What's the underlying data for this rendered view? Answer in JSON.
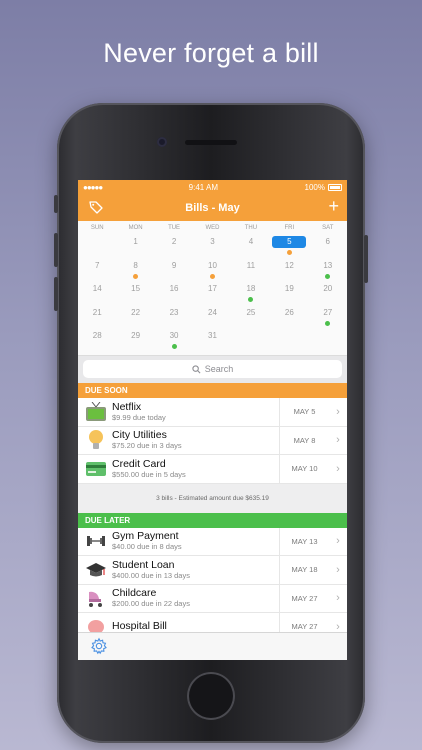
{
  "headline": "Never forget a bill",
  "status": {
    "carrier_dots": "●●●●●",
    "time": "9:41 AM",
    "battery": "100%"
  },
  "nav": {
    "title": "Bills - May",
    "tag_icon": "tag-icon",
    "add_label": "+"
  },
  "calendar": {
    "weekdays": [
      "SUN",
      "MON",
      "TUE",
      "WED",
      "THU",
      "FRI",
      "SAT"
    ],
    "weeks": [
      [
        {
          "d": ""
        },
        {
          "d": "1"
        },
        {
          "d": "2"
        },
        {
          "d": "3"
        },
        {
          "d": "4"
        },
        {
          "d": "5",
          "today": true,
          "dot": "#f5a03a"
        },
        {
          "d": "6"
        }
      ],
      [
        {
          "d": "7"
        },
        {
          "d": "8",
          "dot": "#f5a03a"
        },
        {
          "d": "9"
        },
        {
          "d": "10",
          "dot": "#f5a03a"
        },
        {
          "d": "11"
        },
        {
          "d": "12"
        },
        {
          "d": "13",
          "dot": "#4bbf4b"
        }
      ],
      [
        {
          "d": "14"
        },
        {
          "d": "15"
        },
        {
          "d": "16"
        },
        {
          "d": "17"
        },
        {
          "d": "18",
          "dot": "#4bbf4b"
        },
        {
          "d": "19"
        },
        {
          "d": "20"
        }
      ],
      [
        {
          "d": "21"
        },
        {
          "d": "22"
        },
        {
          "d": "23"
        },
        {
          "d": "24"
        },
        {
          "d": "25"
        },
        {
          "d": "26"
        },
        {
          "d": "27",
          "dot": "#4bbf4b"
        }
      ],
      [
        {
          "d": "28"
        },
        {
          "d": "29"
        },
        {
          "d": "30",
          "dot": "#4bbf4b"
        },
        {
          "d": "31"
        },
        {
          "d": ""
        },
        {
          "d": ""
        },
        {
          "d": ""
        }
      ]
    ]
  },
  "search": {
    "placeholder": "Search"
  },
  "due_soon": {
    "header": "DUE SOON",
    "color": "#f5a03a",
    "items": [
      {
        "name": "Netflix",
        "sub": "$9.99 due today",
        "date": "MAY 5",
        "icon": "tv-icon"
      },
      {
        "name": "City Utilities",
        "sub": "$75.20 due in 3 days",
        "date": "MAY 8",
        "icon": "lightbulb-icon"
      },
      {
        "name": "Credit Card",
        "sub": "$550.00 due in 5 days",
        "date": "MAY 10",
        "icon": "credit-card-icon"
      }
    ],
    "summary": "3 bills - Estimated amount due $635.19"
  },
  "due_later": {
    "header": "DUE LATER",
    "color": "#4bbf4b",
    "items": [
      {
        "name": "Gym Payment",
        "sub": "$40.00 due in 8 days",
        "date": "MAY 13",
        "icon": "dumbbell-icon"
      },
      {
        "name": "Student Loan",
        "sub": "$400.00 due in 13 days",
        "date": "MAY 18",
        "icon": "graduation-cap-icon"
      },
      {
        "name": "Childcare",
        "sub": "$200.00 due in 22 days",
        "date": "MAY 27",
        "icon": "stroller-icon"
      },
      {
        "name": "Hospital Bill",
        "sub": "",
        "date": "MAY 27",
        "icon": "hospital-icon"
      }
    ]
  },
  "tabbar": {
    "settings_icon": "gear-icon"
  },
  "accent": {
    "orange": "#f5a03a",
    "green": "#4bbf4b",
    "today_blue": "#1e88e5"
  }
}
